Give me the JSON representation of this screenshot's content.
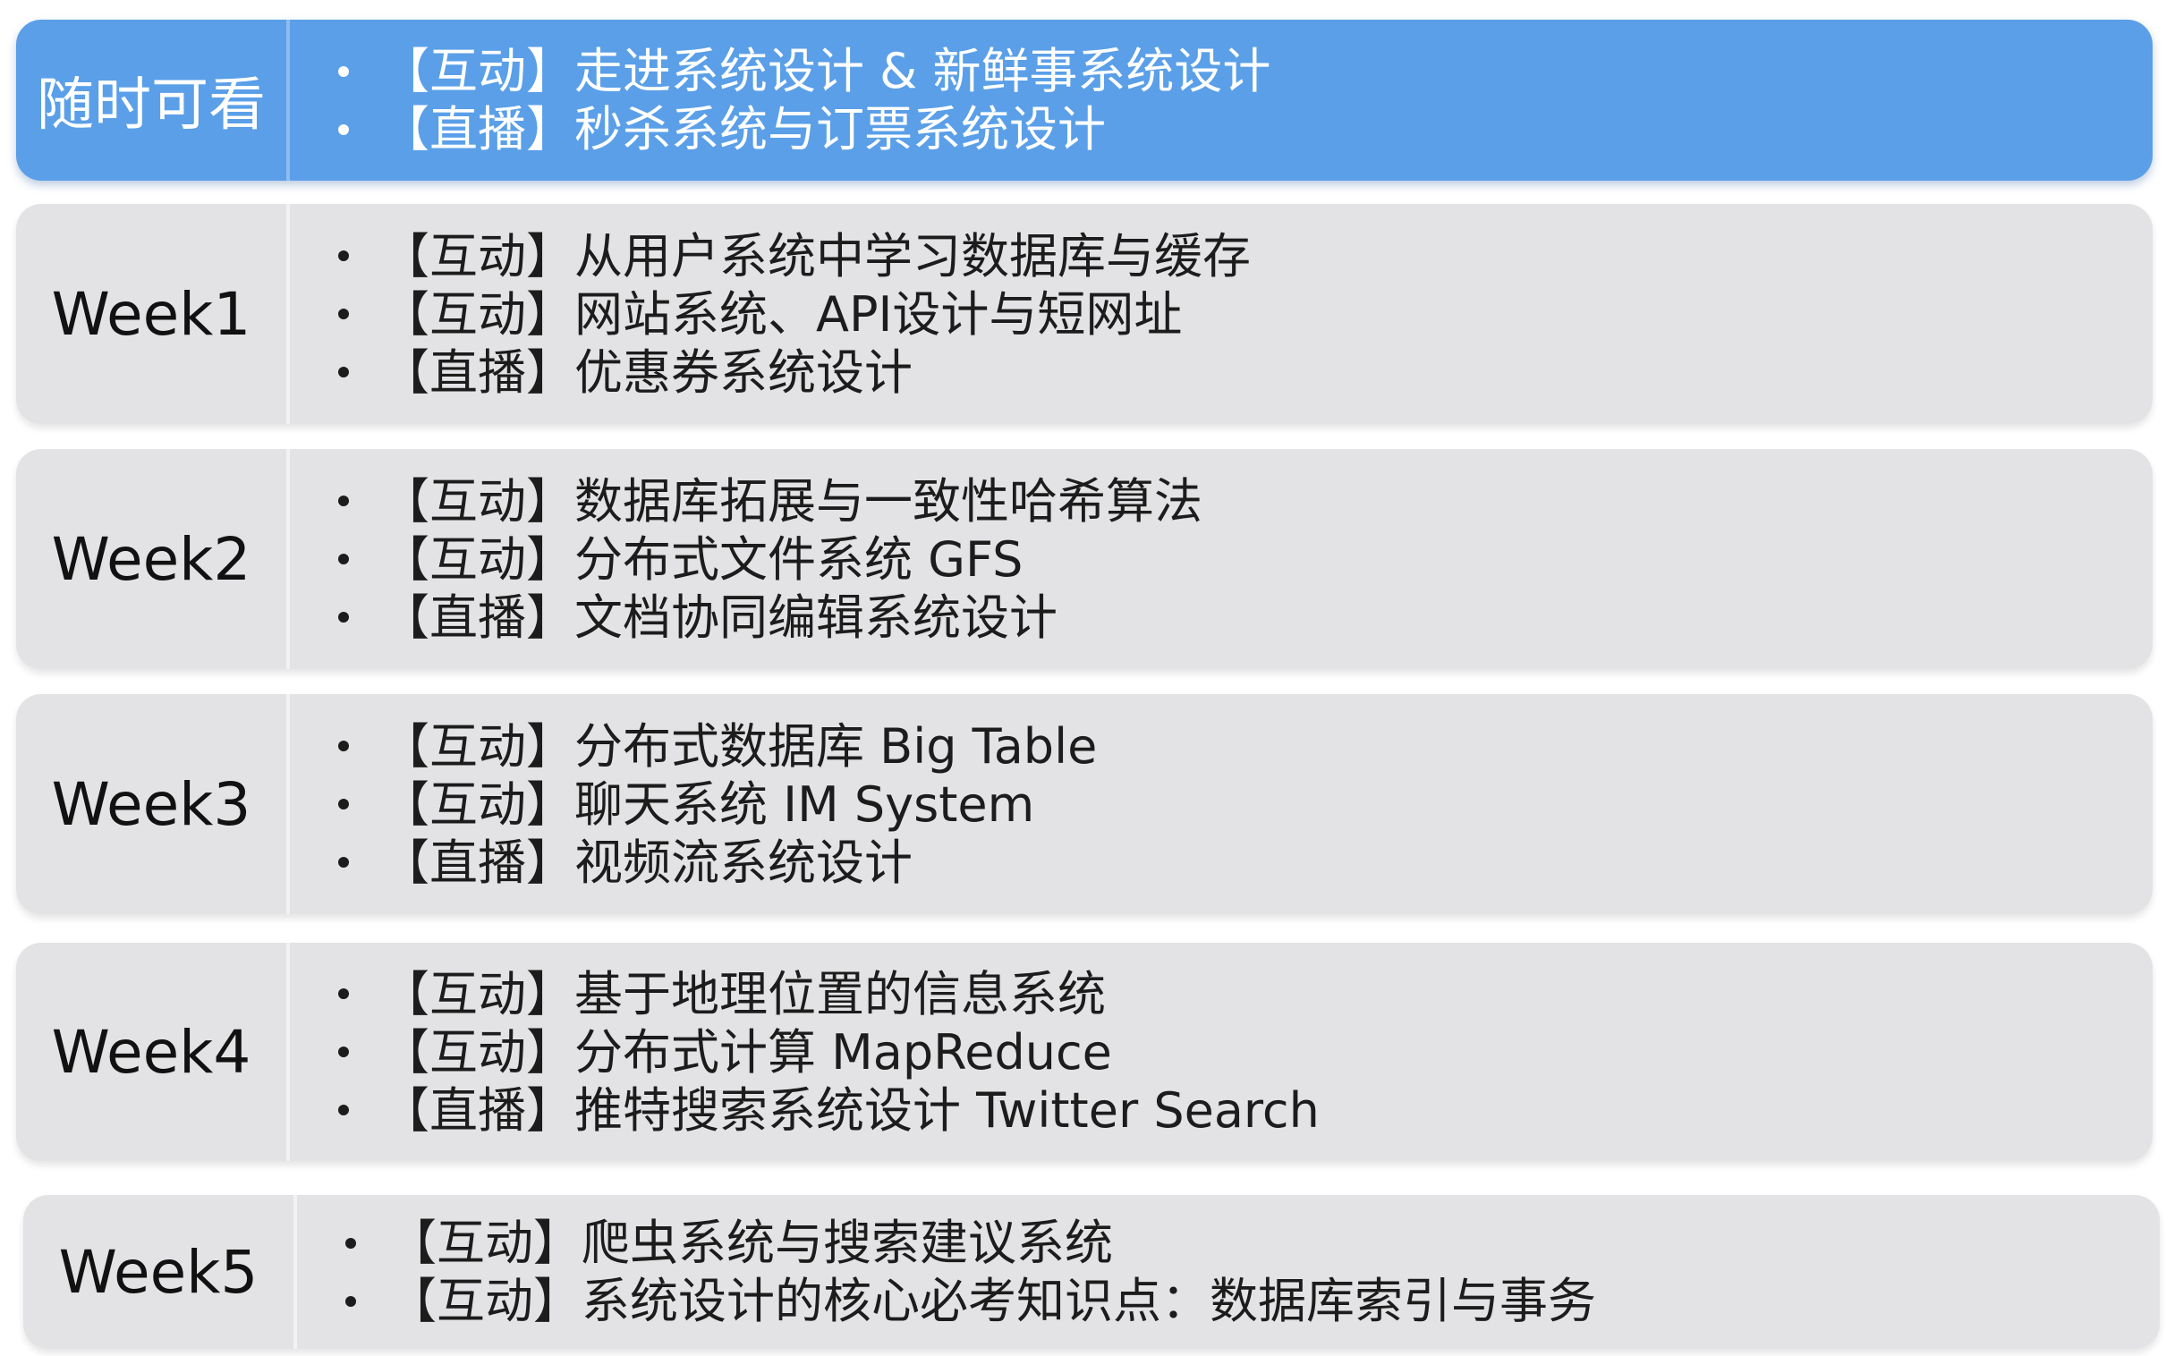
{
  "rows": [
    {
      "label": "随时可看",
      "highlight": true,
      "items": [
        "【互动】走进系统设计 & 新鲜事系统设计",
        "【直播】秒杀系统与订票系统设计"
      ]
    },
    {
      "label": "Week1",
      "highlight": false,
      "items": [
        "【互动】从用户系统中学习数据库与缓存",
        "【互动】网站系统、API设计与短网址",
        "【直播】优惠券系统设计"
      ]
    },
    {
      "label": "Week2",
      "highlight": false,
      "items": [
        "【互动】数据库拓展与一致性哈希算法",
        "【互动】分布式文件系统 GFS",
        "【直播】文档协同编辑系统设计"
      ]
    },
    {
      "label": "Week3",
      "highlight": false,
      "items": [
        "【互动】分布式数据库 Big Table",
        "【互动】聊天系统 IM System",
        "【直播】视频流系统设计"
      ]
    },
    {
      "label": "Week4",
      "highlight": false,
      "items": [
        "【互动】基于地理位置的信息系统",
        "【互动】分布式计算 MapReduce",
        "【直播】推特搜索系统设计 Twitter Search"
      ]
    },
    {
      "label": "Week5",
      "highlight": false,
      "items": [
        "【互动】爬虫系统与搜索建议系统",
        "【互动】系统设计的核心必考知识点：数据库索引与事务"
      ]
    }
  ],
  "colors": {
    "highlight_row": "#5a9fe8",
    "normal_row": "#e3e3e5",
    "highlight_text": "#ffffff",
    "normal_text": "#1c1c1c"
  }
}
